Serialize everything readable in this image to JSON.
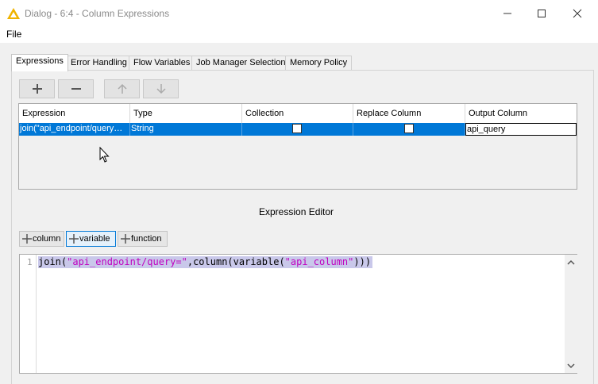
{
  "window": {
    "title": "Dialog - 6:4 - Column Expressions",
    "icon": "warning-triangle-icon"
  },
  "menu": {
    "file": "File"
  },
  "tabs": [
    {
      "label": "Expressions",
      "active": true
    },
    {
      "label": "Error Handling",
      "active": false
    },
    {
      "label": "Flow Variables",
      "active": false
    },
    {
      "label": "Job Manager Selection",
      "active": false
    },
    {
      "label": "Memory Policy",
      "active": false
    }
  ],
  "toolbar": {
    "add_icon": "plus-icon",
    "remove_icon": "minus-icon",
    "up_icon": "arrow-up-icon",
    "down_icon": "arrow-down-icon"
  },
  "table": {
    "columns": [
      "Expression",
      "Type",
      "Collection",
      "Replace Column",
      "Output Column"
    ],
    "rows": [
      {
        "expression": "join(\"api_endpoint/query…",
        "type": "String",
        "collection": false,
        "replace_column": false,
        "output_column": "api_query"
      }
    ]
  },
  "editor": {
    "label": "Expression Editor",
    "insert_buttons": [
      "column",
      "variable",
      "function"
    ],
    "line_number": "1",
    "code_tokens": [
      {
        "t": "join(",
        "k": "fn"
      },
      {
        "t": "\"api_endpoint/query=\"",
        "k": "str"
      },
      {
        "t": ",column(variable(",
        "k": "fn"
      },
      {
        "t": "\"api_column\"",
        "k": "str"
      },
      {
        "t": ")))",
        "k": "p"
      }
    ]
  },
  "colors": {
    "selection": "#0078d7",
    "code_highlight": "#c9c8ea",
    "string": "#c000c0",
    "warning_icon": "#f0b400"
  }
}
